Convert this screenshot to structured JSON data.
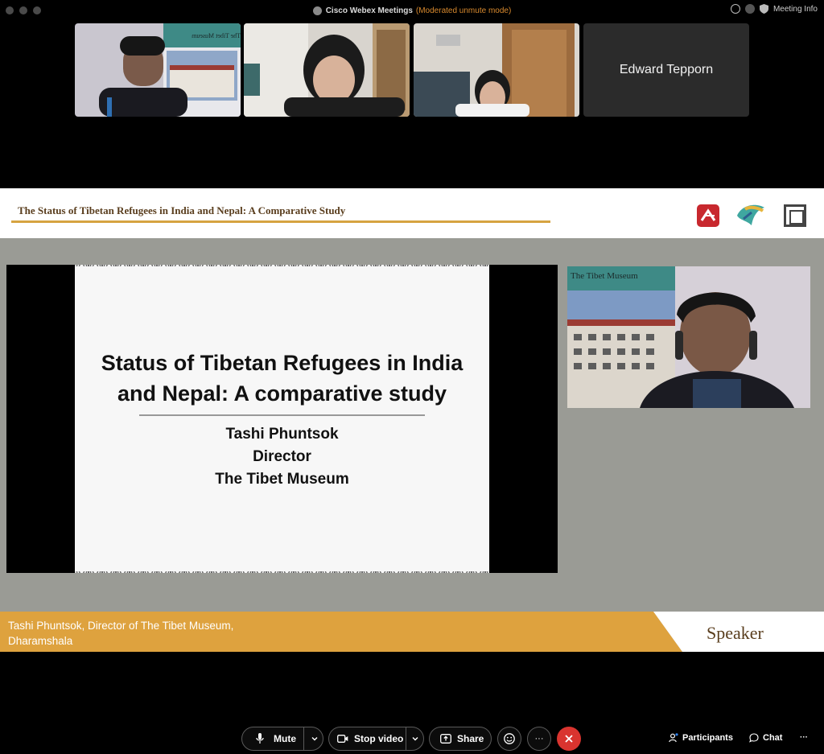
{
  "window": {
    "app_title": "Cisco Webex Meetings",
    "mode": "(Moderated unmute mode)",
    "meeting_info": "Meeting Info"
  },
  "participants": {
    "tile_4_name": "Edward Tepporn"
  },
  "thumbnail_1": {
    "banner_text": "The Tibet Museum"
  },
  "shared": {
    "header_title": "The Status of Tibetan Refugees in India and Nepal: A Comparative Study",
    "speaker_banner_text": "The Tibet Museum",
    "lower_third_line1": "Tashi Phuntsok, Director of The Tibet Museum,",
    "lower_third_line2": "Dharamshala",
    "speaker_tag": "Speaker"
  },
  "slide": {
    "title_line1": "Status of Tibetan Refugees in India",
    "title_line2": "and Nepal: A comparative study",
    "author": "Tashi Phuntsok",
    "role": "Director",
    "organization": "The Tibet Museum"
  },
  "toolbar": {
    "mute_label": "Mute",
    "stop_video_label": "Stop video",
    "share_label": "Share",
    "more_label": "···",
    "participants_label": "Participants",
    "chat_label": "Chat",
    "overflow_label": "···"
  },
  "colors": {
    "accent_gold": "#d6a341",
    "end_call_red": "#d9342f",
    "mode_orange": "#d98a2e"
  }
}
